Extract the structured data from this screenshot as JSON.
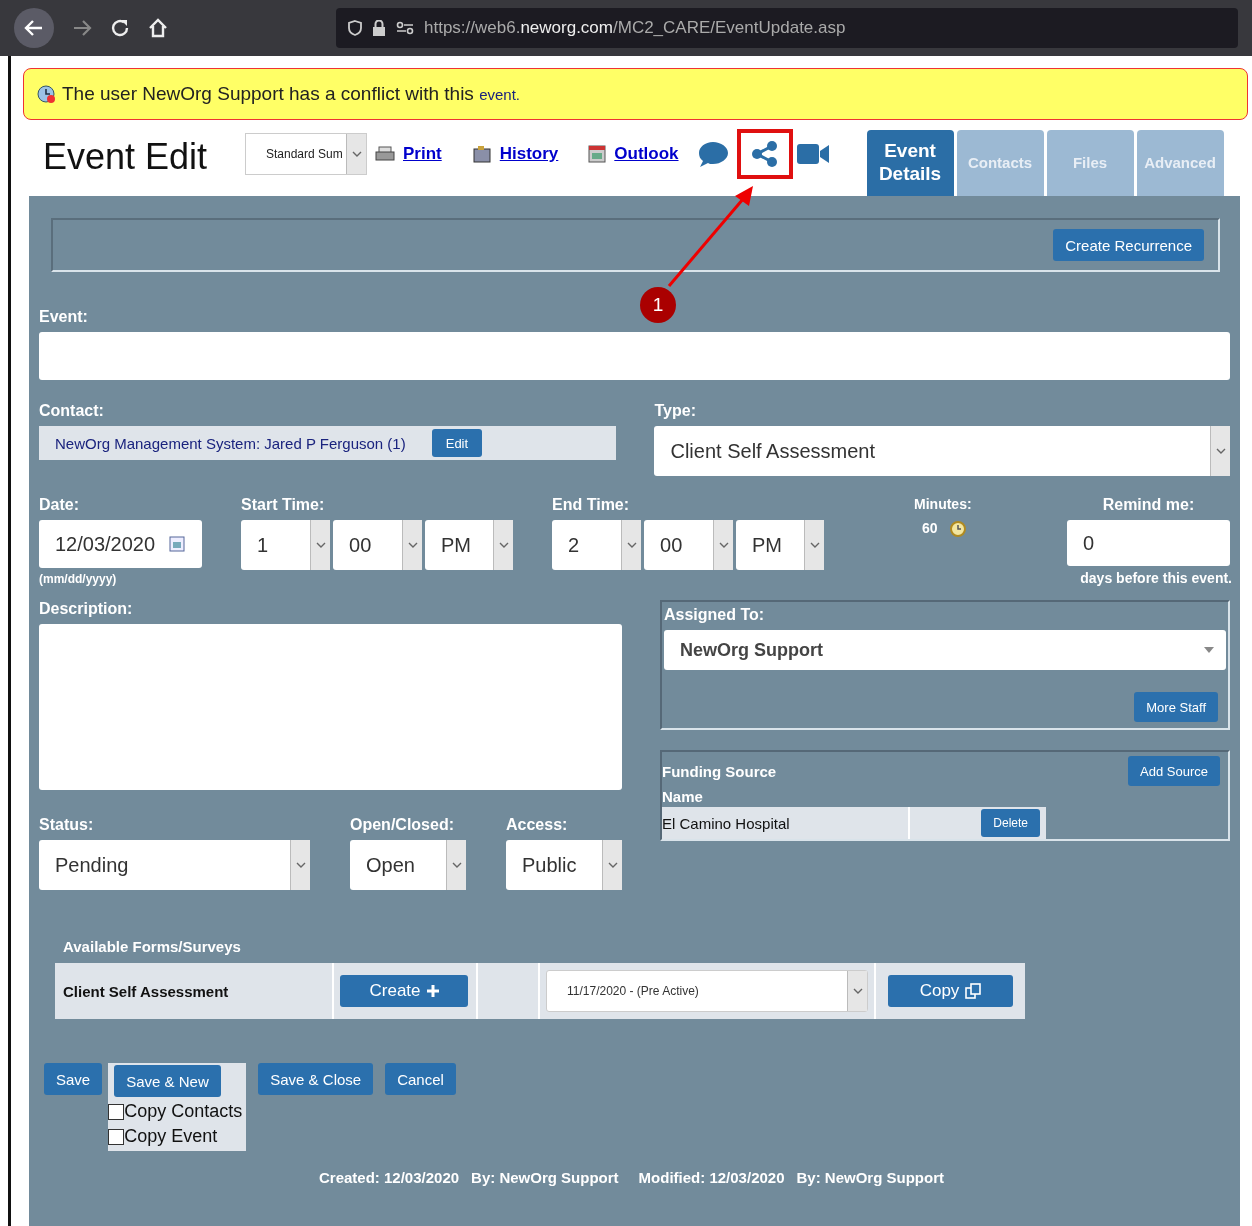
{
  "browser": {
    "url_host": "https://web6.",
    "url_domain": "neworg.com",
    "url_path": "/MC2_CARE/EventUpdate.asp"
  },
  "alert": {
    "text": "The user NewOrg Support has a conflict with this",
    "link": "event."
  },
  "header": {
    "title": "Event Edit",
    "view_select": "Standard Sum",
    "links": [
      {
        "label": "Print",
        "kind": "print"
      },
      {
        "label": "History",
        "kind": "history"
      },
      {
        "label": "Outlook",
        "kind": "outlook"
      }
    ],
    "tabs": [
      {
        "label": "Event Details",
        "selected": true
      },
      {
        "label": "Contacts",
        "selected": false
      },
      {
        "label": "Files",
        "selected": false
      },
      {
        "label": "Advanced",
        "selected": false
      }
    ]
  },
  "annotation": {
    "number": "1"
  },
  "recurrence_button": "Create Recurrence",
  "event": {
    "label": "Event:"
  },
  "contact": {
    "label": "Contact:",
    "value": "NewOrg Management System: Jared P Ferguson (1)",
    "button": "Edit"
  },
  "type": {
    "label": "Type:",
    "value": "Client Self Assessment"
  },
  "date": {
    "label": "Date:",
    "value": "12/03/2020",
    "hint": "(mm/dd/yyyy)"
  },
  "start_time": {
    "label": "Start Time:",
    "hour": "1",
    "minute": "00",
    "ampm": "PM"
  },
  "end_time": {
    "label": "End Time:",
    "hour": "2",
    "minute": "00",
    "ampm": "PM"
  },
  "minutes": {
    "label": "Minutes:",
    "value": "60"
  },
  "remind": {
    "label": "Remind me:",
    "value": "0",
    "hint": "days before this event."
  },
  "description": {
    "label": "Description:"
  },
  "assigned": {
    "label": "Assigned To:",
    "value": "NewOrg Support",
    "button": "More Staff"
  },
  "funding": {
    "title": "Funding Source",
    "button": "Add Source",
    "column": "Name",
    "rows": [
      {
        "name": "El Camino Hospital",
        "button": "Delete"
      }
    ]
  },
  "status": {
    "label": "Status:",
    "value": "Pending"
  },
  "open_closed": {
    "label": "Open/Closed:",
    "value": "Open"
  },
  "access": {
    "label": "Access:",
    "value": "Public"
  },
  "forms": {
    "title": "Available Forms/Surveys",
    "rows": [
      {
        "name": "Client Self Assessment",
        "create": "Create",
        "version": "11/17/2020 - (Pre Active)",
        "copy": "Copy"
      }
    ]
  },
  "actions": [
    {
      "label": "Save",
      "kind": "plain"
    },
    {
      "label": "Save & New",
      "kind": "options"
    },
    {
      "label": "Save & Close",
      "kind": "plain"
    },
    {
      "label": "Cancel",
      "kind": "plain"
    }
  ],
  "copy_options": [
    {
      "label": "Copy Contacts",
      "checked": false
    },
    {
      "label": "Copy Event",
      "checked": false
    }
  ],
  "footer": [
    "Created: 12/03/2020",
    "By: NewOrg Support",
    "Modified: 12/03/2020",
    "By: NewOrg Support"
  ]
}
